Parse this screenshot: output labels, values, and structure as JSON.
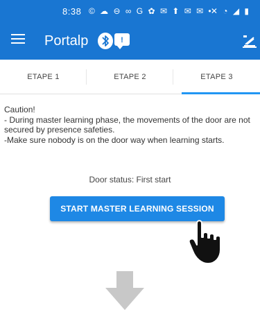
{
  "statusbar": {
    "time": "8:38",
    "notification_icons": "© ☁ ⊖ ∞ G ✿ ✉ ⬆ ✉ ✉ •",
    "system_icons": "✕ ◔ ◢ ▮"
  },
  "appbar": {
    "title": "Portalp"
  },
  "tabs": [
    {
      "label": "ETAPE 1"
    },
    {
      "label": "ETAPE 2"
    },
    {
      "label": "ETAPE 3"
    }
  ],
  "caution": {
    "line1": "Caution!",
    "line2": "- During master learning phase, the movements of the door are not secured by presence safeties.",
    "line3": "-Make sure nobody is on the door way when learning starts."
  },
  "door_status": "Door status: First start",
  "start_button_label": "START MASTER LEARNING SESSION",
  "colors": {
    "primary": "#1976d2",
    "button": "#1e88e5",
    "tab_indicator": "#2196f3"
  },
  "icons": {
    "menu": "menu-icon",
    "bluetooth": "bluetooth-icon",
    "chat": "chat-icon",
    "door": "door-icon",
    "hand": "pointing-hand-icon",
    "arrow": "down-arrow-icon"
  }
}
